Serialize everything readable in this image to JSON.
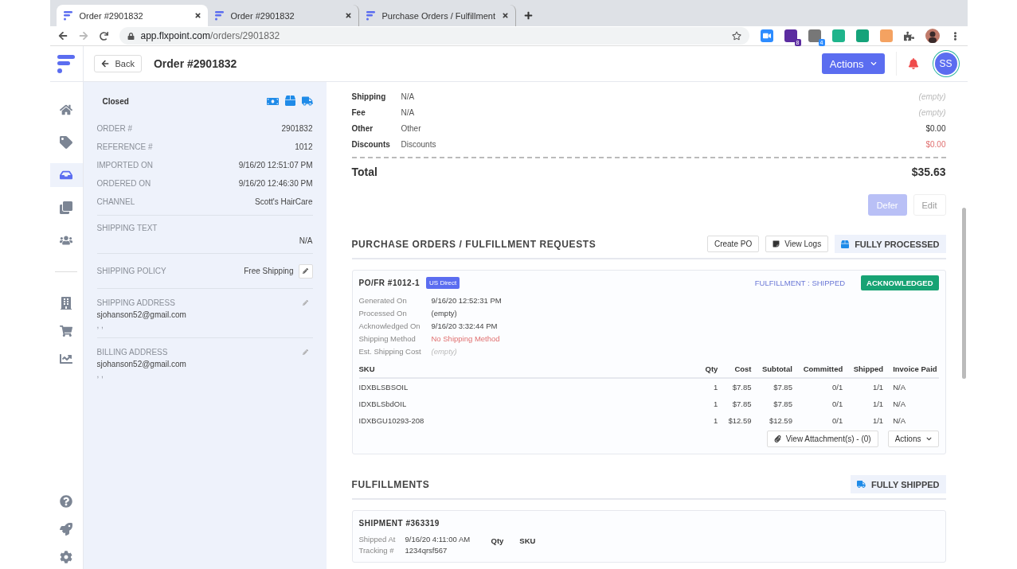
{
  "browser": {
    "tabs": [
      {
        "title": "Order #2901832",
        "selected": true
      },
      {
        "title": "Order #2901832",
        "selected": false
      },
      {
        "title": "Purchase Orders / Fulfillment",
        "selected": false
      }
    ],
    "address": {
      "host": "app.flxpoint.com",
      "path": "/orders/2901832"
    },
    "extension_badges": [
      "8",
      "4"
    ]
  },
  "header": {
    "back": "Back",
    "title": "Order #2901832",
    "actions": "Actions",
    "avatar": "SS"
  },
  "nav": [
    {
      "selected": false
    },
    {
      "selected": false
    },
    {
      "selected": true
    },
    {
      "selected": false
    },
    {
      "selected": false
    },
    {
      "selected": false
    },
    {
      "selected": false
    },
    {
      "selected": false
    },
    {
      "selected": false
    },
    {
      "selected": false
    },
    {
      "selected": false
    }
  ],
  "order_panel": {
    "status": "Closed",
    "fields": [
      {
        "label": "ORDER #",
        "value": "2901832"
      },
      {
        "label": "REFERENCE #",
        "value": "1012"
      },
      {
        "label": "IMPORTED ON",
        "value": "9/16/20 12:51:07 PM"
      },
      {
        "label": "ORDERED ON",
        "value": "9/16/20 12:46:30 PM"
      },
      {
        "label": "CHANNEL",
        "value": "Scott's HairCare"
      }
    ],
    "shipping_text": {
      "label": "SHIPPING TEXT",
      "value": "N/A"
    },
    "shipping_policy": {
      "label": "SHIPPING POLICY",
      "value": "Free Shipping"
    },
    "addresses": [
      {
        "label": "SHIPPING ADDRESS",
        "email": "sjohanson52@gmail.com",
        "line": ", ,"
      },
      {
        "label": "BILLING ADDRESS",
        "email": "sjohanson52@gmail.com",
        "line": ", ,"
      }
    ]
  },
  "charges": [
    {
      "label": "Shipping",
      "value": "N/A",
      "amount": "(empty)",
      "kind": "empty"
    },
    {
      "label": "Fee",
      "value": "N/A",
      "amount": "(empty)",
      "kind": "empty"
    },
    {
      "label": "Other",
      "value": "Other",
      "amount": "$0.00",
      "kind": "normal"
    },
    {
      "label": "Discounts",
      "value": "Discounts",
      "amount": "$0.00",
      "kind": "negative"
    }
  ],
  "total": {
    "label": "Total",
    "value": "$35.63"
  },
  "total_buttons": [
    {
      "label": "Defer",
      "disabled": true
    },
    {
      "label": "Edit",
      "disabled": false
    }
  ],
  "purchase_orders": {
    "title": "PURCHASE ORDERS / FULFILLMENT REQUESTS",
    "create": "Create PO",
    "logs": "View Logs",
    "status": "FULLY PROCESSED",
    "card": {
      "title": "PO/FR #1012-1",
      "tag": "US Direct",
      "fulfillment": "FULFILLMENT : SHIPPED",
      "state": "ACKNOWLEDGED",
      "details": [
        {
          "label": "Generated On",
          "value": "9/16/20 12:52:31 PM",
          "kind": "normal"
        },
        {
          "label": "Processed On",
          "value": "(empty)",
          "kind": "normal"
        },
        {
          "label": "Acknowledged On",
          "value": "9/16/20 3:32:44 PM",
          "kind": "normal"
        },
        {
          "label": "Shipping Method",
          "value": "No Shipping Method",
          "kind": "warning"
        },
        {
          "label": "Est. Shipping Cost",
          "value": "(empty)",
          "kind": "empty"
        }
      ],
      "columns": [
        "SKU",
        "Qty",
        "Cost",
        "Subtotal",
        "Committed",
        "Shipped",
        "Invoice Paid"
      ],
      "rows": [
        [
          "IDXBLSBSOIL",
          "1",
          "$7.85",
          "$7.85",
          "0/1",
          "1/1",
          "N/A"
        ],
        [
          "IDXBLSbdOIL",
          "1",
          "$7.85",
          "$7.85",
          "0/1",
          "1/1",
          "N/A"
        ],
        [
          "IDXBGU10293-208",
          "1",
          "$12.59",
          "$12.59",
          "0/1",
          "1/1",
          "N/A"
        ]
      ],
      "attachments": "View Attachment(s) - (0)",
      "actions": "Actions"
    }
  },
  "fulfillments": {
    "title": "FULFILLMENTS",
    "status": "FULLY SHIPPED",
    "shipment": {
      "title": "SHIPMENT #363319",
      "details": [
        {
          "label": "Shipped At",
          "value": "9/16/20 4:11:00 AM"
        },
        {
          "label": "Tracking #",
          "value": "1234qrsf567"
        }
      ],
      "columns": [
        "Qty",
        "SKU"
      ]
    }
  }
}
